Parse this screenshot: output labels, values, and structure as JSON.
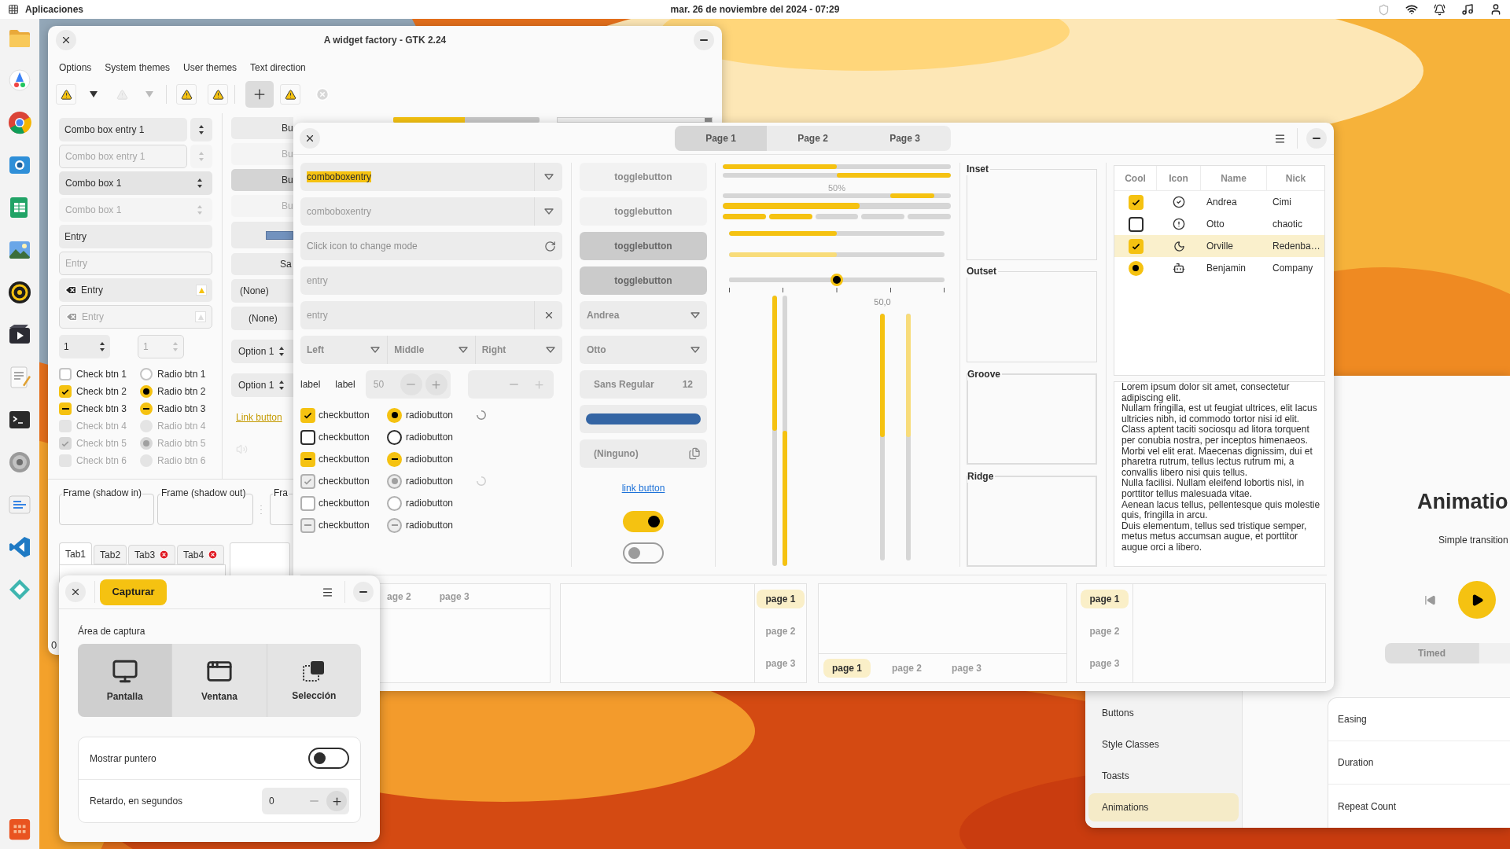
{
  "top_bar": {
    "apps_label": "Aplicaciones",
    "clock": "mar. 26 de noviembre del 2024 - 07:29"
  },
  "gtk2_window": {
    "title": "A widget factory - GTK 2.24",
    "menu": [
      "Options",
      "System themes",
      "User themes",
      "Text direction"
    ],
    "combos": [
      {
        "value": "Combo box entry 1",
        "kind": "entry",
        "disabled": false
      },
      {
        "value": "Combo box entry 1",
        "kind": "entry",
        "disabled": true
      },
      {
        "value": "Combo box 1",
        "kind": "combo",
        "disabled": false
      },
      {
        "value": "Combo box 1",
        "kind": "combo",
        "disabled": true
      }
    ],
    "entries": [
      {
        "value": "Entry",
        "kind": "plain",
        "disabled": false
      },
      {
        "value": "Entry",
        "kind": "plain",
        "disabled": true
      },
      {
        "value": "Entry",
        "kind": "icons",
        "disabled": false
      },
      {
        "value": "Entry",
        "kind": "icons",
        "disabled": true
      }
    ],
    "spins": [
      {
        "value": "1",
        "disabled": false
      },
      {
        "value": "1",
        "disabled": true
      }
    ],
    "checks": [
      {
        "label": "Check btn 1",
        "checked": false,
        "inconsistent": false,
        "disabled": false
      },
      {
        "label": "Check btn 2",
        "checked": true,
        "inconsistent": false,
        "disabled": false
      },
      {
        "label": "Check btn 3",
        "checked": true,
        "inconsistent": true,
        "disabled": false
      },
      {
        "label": "Check btn 4",
        "checked": false,
        "inconsistent": false,
        "disabled": true
      },
      {
        "label": "Check btn 5",
        "checked": true,
        "inconsistent": false,
        "disabled": true
      },
      {
        "label": "Check btn 6",
        "checked": false,
        "inconsistent": false,
        "disabled": true
      }
    ],
    "radios": [
      {
        "label": "Radio btn 1",
        "checked": false,
        "inconsistent": false,
        "disabled": false
      },
      {
        "label": "Radio btn 2",
        "checked": true,
        "inconsistent": false,
        "disabled": false
      },
      {
        "label": "Radio btn 3",
        "checked": true,
        "inconsistent": true,
        "disabled": false
      },
      {
        "label": "Radio btn 4",
        "checked": false,
        "inconsistent": false,
        "disabled": true
      },
      {
        "label": "Radio btn 5",
        "checked": true,
        "inconsistent": false,
        "disabled": true
      },
      {
        "label": "Radio btn 6",
        "checked": false,
        "inconsistent": false,
        "disabled": true
      }
    ],
    "buttons": [
      {
        "label": "Bu",
        "pressed": false,
        "disabled": false
      },
      {
        "label": "Bu",
        "pressed": false,
        "disabled": true
      },
      {
        "label": "Bu",
        "pressed": true,
        "disabled": false
      },
      {
        "label": "Bu",
        "pressed": false,
        "disabled": true
      }
    ],
    "save_button": "Sa",
    "none_combos": [
      "(None)",
      "(None)"
    ],
    "option_spins": [
      "Option 1",
      "Option 1"
    ],
    "link": "Link button",
    "progress": {
      "level": 0.49
    },
    "frames": [
      "Frame (shadow in)",
      "Frame (shadow out)",
      "Fra"
    ],
    "tabs": [
      {
        "label": "Tab1",
        "selected": true,
        "closable": false
      },
      {
        "label": "Tab2",
        "selected": false,
        "closable": false
      },
      {
        "label": "Tab3",
        "selected": false,
        "closable": true
      },
      {
        "label": "Tab4",
        "selected": false,
        "closable": true
      }
    ],
    "spin_value": "0"
  },
  "gtk3_window": {
    "tabs": [
      {
        "label": "Page 1",
        "selected": true
      },
      {
        "label": "Page 2",
        "selected": false
      },
      {
        "label": "Page 3",
        "selected": false
      }
    ],
    "combo_entries": [
      {
        "value": "comboboxentry",
        "disabled": false
      },
      {
        "value": "comboboxentry",
        "disabled": true
      }
    ],
    "mode_entry": {
      "placeholder": "Click icon to change mode"
    },
    "entries": [
      {
        "placeholder": "entry",
        "clearable": false
      },
      {
        "placeholder": "entry",
        "clearable": true
      }
    ],
    "aligned_combos": [
      "Left",
      "Middle",
      "Right"
    ],
    "labels": [
      "label",
      "label"
    ],
    "spin": {
      "value": "50"
    },
    "checkbuttons": [
      {
        "label": "checkbutton",
        "checked": true,
        "inconsistent": false,
        "disabled": false
      },
      {
        "label": "checkbutton",
        "checked": false,
        "inconsistent": false,
        "disabled": false
      },
      {
        "label": "checkbutton",
        "checked": true,
        "inconsistent": true,
        "disabled": false
      },
      {
        "label": "checkbutton",
        "checked": true,
        "inconsistent": false,
        "disabled": true
      },
      {
        "label": "checkbutton",
        "checked": false,
        "inconsistent": false,
        "disabled": true
      },
      {
        "label": "checkbutton",
        "checked": true,
        "inconsistent": true,
        "disabled": true
      }
    ],
    "radiobuttons": [
      {
        "label": "radiobutton",
        "checked": true,
        "inconsistent": false,
        "disabled": false
      },
      {
        "label": "radiobutton",
        "checked": false,
        "inconsistent": false,
        "disabled": false
      },
      {
        "label": "radiobutton",
        "checked": true,
        "inconsistent": true,
        "disabled": false
      },
      {
        "label": "radiobutton",
        "checked": true,
        "inconsistent": false,
        "disabled": true
      },
      {
        "label": "radiobutton",
        "checked": false,
        "inconsistent": false,
        "disabled": true
      },
      {
        "label": "radiobutton",
        "checked": true,
        "inconsistent": true,
        "disabled": true
      }
    ],
    "togglebuttons": [
      {
        "label": "togglebutton",
        "active": false
      },
      {
        "label": "togglebutton",
        "active": false
      },
      {
        "label": "togglebutton",
        "active": true
      },
      {
        "label": "togglebutton",
        "active": true
      }
    ],
    "name_combos": [
      "Andrea",
      "Otto"
    ],
    "font_button": {
      "name": "Sans Regular",
      "size": "12"
    },
    "file_button": "(Ninguno)",
    "link": "link button",
    "switches": [
      {
        "on": true
      },
      {
        "on": false
      }
    ],
    "bars": [
      {
        "level": 0.5,
        "inverted": false
      },
      {
        "level": 0.5,
        "inverted": true
      }
    ],
    "progress_label": "50%",
    "level_bar": {
      "level": 0.6
    },
    "segment_bar": {
      "level": 0.4
    },
    "scales": [
      {
        "level": 0.5,
        "disabled": false
      },
      {
        "level": 0.5,
        "disabled": true
      }
    ],
    "slider": {
      "level": 0.5,
      "value": "50,0"
    },
    "vertical_bars": [
      {
        "level": 0.5,
        "inverted": false,
        "disabled": false
      },
      {
        "level": 0.5,
        "inverted": true,
        "disabled": false
      },
      {
        "level": 0.5,
        "inverted": false,
        "disabled": false
      },
      {
        "level": 0.5,
        "inverted": false,
        "disabled": true
      }
    ],
    "frames": [
      "Inset",
      "Outset",
      "Groove",
      "Ridge"
    ],
    "tree": {
      "columns": [
        "Cool",
        "Icon",
        "Name",
        "Nick"
      ],
      "rows": [
        {
          "kind": "check",
          "checked": true,
          "name": "Andrea",
          "nick": "Cimi",
          "selected": false
        },
        {
          "kind": "check",
          "checked": false,
          "name": "Otto",
          "nick": "chaotic",
          "selected": false
        },
        {
          "kind": "check",
          "checked": true,
          "name": "Orville",
          "nick": "Redenba…",
          "selected": true
        },
        {
          "kind": "radio",
          "checked": true,
          "name": "Benjamin",
          "nick": "Company",
          "selected": false
        }
      ]
    },
    "text_view": [
      "Lorem ipsum dolor sit amet, consectetur adipiscing elit.",
      "Nullam fringilla, est ut feugiat ultrices, elit lacus ultricies nibh, id commodo tortor nisi id elit.",
      "Class aptent taciti sociosqu ad litora torquent per conubia nostra, per inceptos himenaeos.",
      "Morbi vel elit erat. Maecenas dignissim, dui et pharetra rutrum, tellus lectus rutrum mi, a convallis libero nisi quis tellus.",
      "Nulla facilisi. Nullam eleifend lobortis nisl, in porttitor tellus malesuada vitae.",
      "Aenean lacus tellus, pellentesque quis molestie quis, fringilla in arcu.",
      "Duis elementum, tellus sed tristique semper, metus metus accumsan augue, et porttitor augue orci a libero."
    ],
    "notebooks": [
      {
        "kind": "top",
        "tabs": [
          {
            "label": "age 2",
            "selected": false
          },
          {
            "label": "page 3",
            "selected": false
          }
        ]
      },
      {
        "kind": "right",
        "tabs": [
          {
            "label": "page 1",
            "selected": true
          },
          {
            "label": "page 2",
            "selected": false
          },
          {
            "label": "page 3",
            "selected": false
          }
        ]
      },
      {
        "kind": "bottom",
        "tabs": [
          {
            "label": "page 1",
            "selected": true
          },
          {
            "label": "page 2",
            "selected": false
          },
          {
            "label": "page 3",
            "selected": false
          }
        ]
      },
      {
        "kind": "left",
        "tabs": [
          {
            "label": "page 1",
            "selected": true
          },
          {
            "label": "page 2",
            "selected": false
          },
          {
            "label": "page 3",
            "selected": false
          }
        ]
      }
    ]
  },
  "capture_dialog": {
    "action": "Capturar",
    "area_label": "Área de captura",
    "modes": [
      {
        "label": "Pantalla",
        "selected": true
      },
      {
        "label": "Ventana",
        "selected": false
      },
      {
        "label": "Selección",
        "selected": false
      }
    ],
    "pointer": {
      "label": "Mostrar puntero",
      "on": false
    },
    "delay": {
      "label": "Retardo, en segundos",
      "value": "0"
    }
  },
  "demo_window": {
    "sidebar": [
      {
        "label": "Buttons",
        "selected": false
      },
      {
        "label": "Style Classes",
        "selected": false
      },
      {
        "label": "Toasts",
        "selected": false
      },
      {
        "label": "Animations",
        "selected": true
      }
    ],
    "title": "Animatio",
    "subtitle": "Simple transition",
    "modes": [
      {
        "label": "Timed",
        "selected": true
      }
    ],
    "rows": [
      "Easing",
      "Duration",
      "Repeat Count"
    ]
  }
}
